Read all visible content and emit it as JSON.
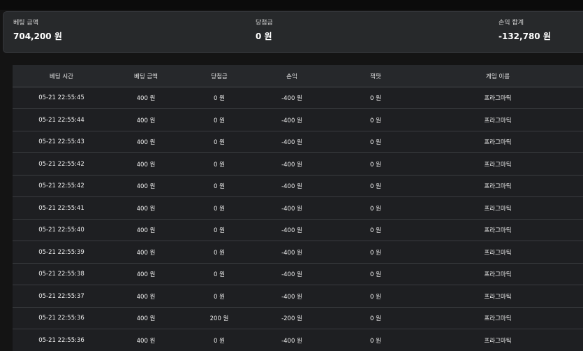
{
  "summary": {
    "bet_amount_label": "베팅 금액",
    "bet_amount_value": "704,200 원",
    "winnings_label": "당첨금",
    "winnings_value": "0 원",
    "profit_label": "손익 합계",
    "profit_value": "-132,780 원"
  },
  "table": {
    "headers": [
      "베팅 시간",
      "베팅 금액",
      "당첨금",
      "손익",
      "잭팟",
      "게임 이름"
    ],
    "rows": [
      [
        "05-21 22:55:45",
        "400 원",
        "0 원",
        "-400 원",
        "0 원",
        "프라그마틱"
      ],
      [
        "05-21 22:55:44",
        "400 원",
        "0 원",
        "-400 원",
        "0 원",
        "프라그마틱"
      ],
      [
        "05-21 22:55:43",
        "400 원",
        "0 원",
        "-400 원",
        "0 원",
        "프라그마틱"
      ],
      [
        "05-21 22:55:42",
        "400 원",
        "0 원",
        "-400 원",
        "0 원",
        "프라그마틱"
      ],
      [
        "05-21 22:55:42",
        "400 원",
        "0 원",
        "-400 원",
        "0 원",
        "프라그마틱"
      ],
      [
        "05-21 22:55:41",
        "400 원",
        "0 원",
        "-400 원",
        "0 원",
        "프라그마틱"
      ],
      [
        "05-21 22:55:40",
        "400 원",
        "0 원",
        "-400 원",
        "0 원",
        "프라그마틱"
      ],
      [
        "05-21 22:55:39",
        "400 원",
        "0 원",
        "-400 원",
        "0 원",
        "프라그마틱"
      ],
      [
        "05-21 22:55:38",
        "400 원",
        "0 원",
        "-400 원",
        "0 원",
        "프라그마틱"
      ],
      [
        "05-21 22:55:37",
        "400 원",
        "0 원",
        "-400 원",
        "0 원",
        "프라그마틱"
      ],
      [
        "05-21 22:55:36",
        "400 원",
        "200 원",
        "-200 원",
        "0 원",
        "프라그마틱"
      ],
      [
        "05-21 22:55:36",
        "400 원",
        "0 원",
        "-400 원",
        "0 원",
        "프라그마틱"
      ]
    ]
  }
}
